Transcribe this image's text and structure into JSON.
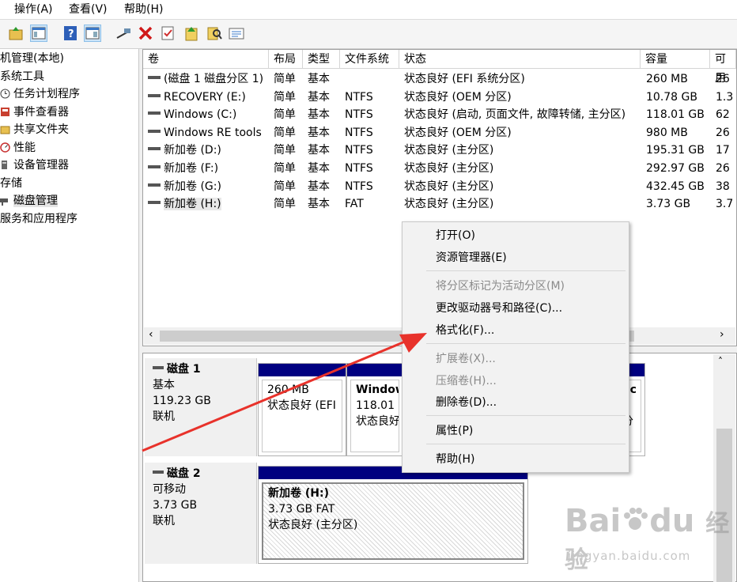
{
  "menubar": {
    "items": [
      "操作(A)",
      "查看(V)",
      "帮助(H)"
    ]
  },
  "toolbar": {
    "icons": [
      "folder-up-icon",
      "show-hide-tree-icon",
      "help-icon",
      "properties-panel-icon",
      "connect-icon",
      "delete-icon",
      "check-icon",
      "import-icon",
      "search-icon",
      "list-icon"
    ]
  },
  "tree": {
    "items": [
      {
        "label": "机管理(本地)",
        "icon": ""
      },
      {
        "label": "系统工具",
        "icon": ""
      },
      {
        "label": "任务计划程序",
        "icon": "clock-icon"
      },
      {
        "label": "事件查看器",
        "icon": "event-viewer-icon"
      },
      {
        "label": "共享文件夹",
        "icon": "shared-folder-icon"
      },
      {
        "label": "性能",
        "icon": "performance-icon"
      },
      {
        "label": "设备管理器",
        "icon": "device-manager-icon"
      },
      {
        "label": "存储",
        "icon": ""
      },
      {
        "label": "磁盘管理",
        "icon": "disk-management-icon"
      },
      {
        "label": "服务和应用程序",
        "icon": ""
      }
    ]
  },
  "volume_table": {
    "columns": [
      "卷",
      "布局",
      "类型",
      "文件系统",
      "状态",
      "容量",
      "可用"
    ],
    "rows": [
      [
        "(磁盘 1 磁盘分区 1)",
        "简单",
        "基本",
        "",
        "状态良好 (EFI 系统分区)",
        "260 MB",
        "26"
      ],
      [
        "RECOVERY (E:)",
        "简单",
        "基本",
        "NTFS",
        "状态良好 (OEM 分区)",
        "10.78 GB",
        "1.3"
      ],
      [
        "Windows (C:)",
        "简单",
        "基本",
        "NTFS",
        "状态良好 (启动, 页面文件, 故障转储, 主分区)",
        "118.01 GB",
        "62"
      ],
      [
        "Windows RE tools",
        "简单",
        "基本",
        "NTFS",
        "状态良好 (OEM 分区)",
        "980 MB",
        "26"
      ],
      [
        "新加卷 (D:)",
        "简单",
        "基本",
        "NTFS",
        "状态良好 (主分区)",
        "195.31 GB",
        "17"
      ],
      [
        "新加卷 (F:)",
        "简单",
        "基本",
        "NTFS",
        "状态良好 (主分区)",
        "292.97 GB",
        "26"
      ],
      [
        "新加卷 (G:)",
        "简单",
        "基本",
        "NTFS",
        "状态良好 (主分区)",
        "432.45 GB",
        "38"
      ],
      [
        "新加卷 (H:)",
        "简单",
        "基本",
        "FAT",
        "状态良好 (主分区)",
        "3.73 GB",
        "3.7"
      ]
    ]
  },
  "scroll": {
    "left": "‹",
    "right": "›",
    "up": "˄"
  },
  "disks": [
    {
      "name": "磁盘 1",
      "kind": "基本",
      "size": "119.23 GB",
      "status": "联机",
      "partitions": [
        {
          "title": "",
          "size": "260 MB",
          "status": "状态良好 (EFI"
        },
        {
          "title": "Window",
          "size": "118.01 G",
          "status": "状态良好"
        },
        {
          "title": "",
          "size": "",
          "status": ""
        },
        {
          "title": "oc",
          "size": "",
          "status": "分"
        }
      ]
    },
    {
      "name": "磁盘 2",
      "kind": "可移动",
      "size": "3.73 GB",
      "status": "联机",
      "partitions": [
        {
          "title": "新加卷  (H:)",
          "size": "3.73 GB FAT",
          "status": "状态良好 (主分区)"
        }
      ]
    }
  ],
  "context_menu": {
    "items": [
      {
        "label": "打开(O)",
        "enabled": true
      },
      {
        "label": "资源管理器(E)",
        "enabled": true
      },
      {
        "label": "将分区标记为活动分区(M)",
        "enabled": false
      },
      {
        "label": "更改驱动器号和路径(C)...",
        "enabled": true
      },
      {
        "label": "格式化(F)...",
        "enabled": true
      },
      {
        "label": "扩展卷(X)...",
        "enabled": false
      },
      {
        "label": "压缩卷(H)...",
        "enabled": false
      },
      {
        "label": "删除卷(D)...",
        "enabled": true
      },
      {
        "label": "属性(P)",
        "enabled": true
      },
      {
        "label": "帮助(H)",
        "enabled": true
      }
    ]
  },
  "annotation": {
    "arrow_color": "#e8322b"
  },
  "watermark": {
    "brand": "Bai",
    "brand2": "du",
    "cn": "经验",
    "url": "jingyan.baidu.com"
  },
  "colors": {
    "partition_bar": "#000080",
    "selection": "#cce4f7"
  }
}
